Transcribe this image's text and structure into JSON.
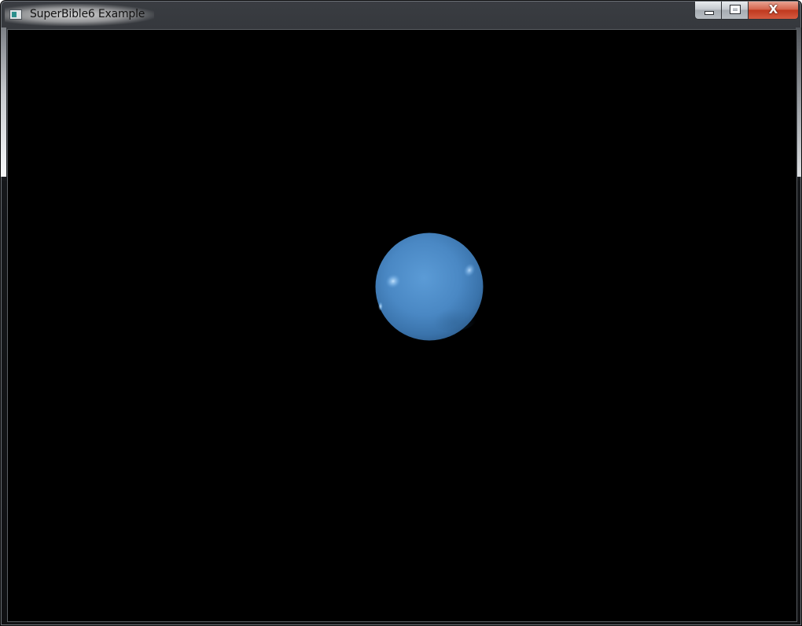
{
  "window": {
    "title": "SuperBible6 Example",
    "app_icon": "app-window-icon"
  },
  "caption_buttons": {
    "minimize_icon": "minimize-icon",
    "maximize_icon": "maximize-icon",
    "close_label": "X",
    "close_color": "#c7402a"
  },
  "canvas": {
    "background": "#000000",
    "object": "sphere",
    "object_color": "#4a88c4"
  }
}
